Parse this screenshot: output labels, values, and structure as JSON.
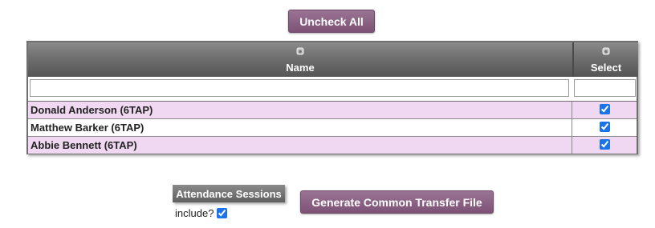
{
  "toolbar": {
    "uncheck_all_label": "Uncheck All"
  },
  "grid": {
    "columns": [
      {
        "label": "Name",
        "icon": "sort-icon"
      },
      {
        "label": "Select",
        "icon": "sort-icon"
      }
    ],
    "filters": {
      "name_value": "",
      "select_value": ""
    },
    "rows": [
      {
        "name": "Donald Anderson (6TAP)",
        "selected": true
      },
      {
        "name": "Matthew Barker (6TAP)",
        "selected": true
      },
      {
        "name": "Abbie Bennett (6TAP)",
        "selected": true
      }
    ]
  },
  "attendance": {
    "header": "Attendance Sessions",
    "include_label": "include?",
    "include_checked": true
  },
  "actions": {
    "generate_label": "Generate Common Transfer File"
  },
  "colors": {
    "accent": "#7d5276",
    "row_highlight": "#f0d8f2",
    "header_gray": "#6f6f6f"
  }
}
